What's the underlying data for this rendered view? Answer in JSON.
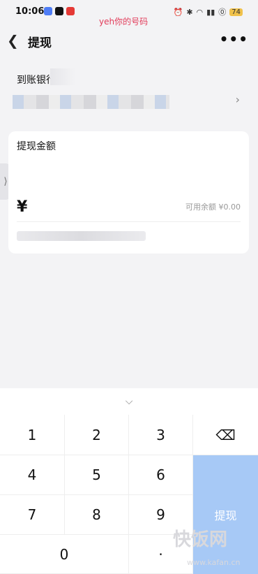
{
  "status_bar": {
    "time": "10:06",
    "battery": "74"
  },
  "watermark_top": "yeh你的号码",
  "nav": {
    "title": "提现"
  },
  "bank": {
    "label": "到账银行卡"
  },
  "card": {
    "title": "提现金额",
    "currency": "¥",
    "available": "可用余额 ¥0.00"
  },
  "keypad": {
    "keys": [
      "1",
      "2",
      "3",
      "4",
      "5",
      "6",
      "7",
      "8",
      "9",
      "0",
      "·"
    ],
    "withdraw_label": "提现"
  },
  "watermark_bottom": {
    "text": "快饭网",
    "url": "www.kafan.cn"
  },
  "colors": {
    "withdraw_button": "#a7c9f6",
    "watermark_top": "#e23c5a"
  }
}
